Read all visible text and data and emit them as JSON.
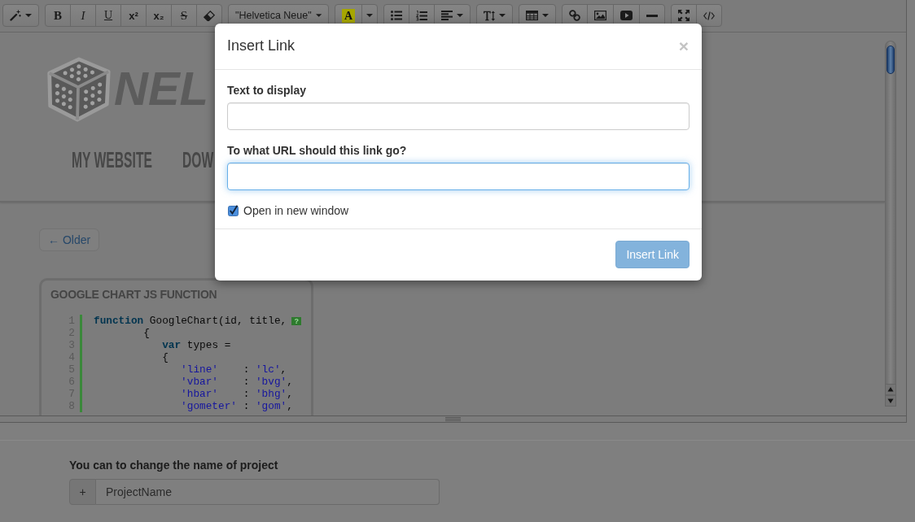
{
  "toolbar": {
    "groups": [
      {
        "buttons": [
          {
            "kind": "magic",
            "caret": true
          }
        ]
      },
      {
        "buttons": [
          {
            "kind": "bold",
            "label": "B",
            "caret": false
          },
          {
            "kind": "italic",
            "label": "I",
            "caret": false
          },
          {
            "kind": "underline",
            "label": "U",
            "caret": false
          },
          {
            "kind": "superscript",
            "label": "x²",
            "caret": false
          },
          {
            "kind": "subscript",
            "label": "x₂",
            "caret": false
          },
          {
            "kind": "strikethrough",
            "label": "S",
            "caret": false
          },
          {
            "kind": "eraser",
            "caret": false
          }
        ]
      },
      {
        "buttons": [
          {
            "kind": "font",
            "label": "\"Helvetica Neue\"",
            "caret": true
          }
        ]
      },
      {
        "buttons": [
          {
            "kind": "color",
            "label": "A",
            "caret": false
          },
          {
            "kind": "dropdown",
            "caret": true
          }
        ]
      },
      {
        "buttons": [
          {
            "kind": "unordered-list",
            "caret": false
          },
          {
            "kind": "ordered-list",
            "caret": false
          },
          {
            "kind": "align",
            "caret": true
          }
        ]
      },
      {
        "buttons": [
          {
            "kind": "text-height",
            "caret": true
          }
        ]
      },
      {
        "buttons": [
          {
            "kind": "table",
            "caret": true
          }
        ]
      },
      {
        "buttons": [
          {
            "kind": "link",
            "caret": false
          },
          {
            "kind": "picture",
            "caret": false
          },
          {
            "kind": "video",
            "caret": false
          },
          {
            "kind": "rule",
            "caret": false
          }
        ]
      },
      {
        "buttons": [
          {
            "kind": "fullscreen",
            "caret": false
          },
          {
            "kind": "code",
            "caret": false
          }
        ]
      }
    ]
  },
  "editor": {
    "logo": {
      "text": "NEL"
    },
    "nav": [
      {
        "label": "MY WEBSITE"
      },
      {
        "label": "DOW"
      }
    ],
    "older_button": {
      "label": "← Older"
    },
    "code_card": {
      "title": "GOOGLE CHART JS FUNCTION",
      "lines": [
        {
          "number": "1",
          "tokens": [
            {
              "kind": "keyword",
              "text": "function"
            },
            {
              "kind": "plain",
              "text": " GoogleChart(id, title,"
            }
          ],
          "marker": "?"
        },
        {
          "number": "2",
          "tokens": [
            {
              "kind": "plain",
              "text": "        {"
            }
          ]
        },
        {
          "number": "3",
          "tokens": [
            {
              "kind": "keyword",
              "text": "           var"
            },
            {
              "kind": "plain",
              "text": " types ="
            }
          ]
        },
        {
          "number": "4",
          "tokens": [
            {
              "kind": "plain",
              "text": "           {"
            }
          ]
        },
        {
          "number": "5",
          "tokens": [
            {
              "kind": "string",
              "text": "              'line'"
            },
            {
              "kind": "plain",
              "text": "    : "
            },
            {
              "kind": "string",
              "text": "'lc'"
            },
            {
              "kind": "plain",
              "text": ","
            }
          ]
        },
        {
          "number": "6",
          "tokens": [
            {
              "kind": "string",
              "text": "              'vbar'"
            },
            {
              "kind": "plain",
              "text": "    : "
            },
            {
              "kind": "string",
              "text": "'bvg'"
            },
            {
              "kind": "plain",
              "text": ","
            }
          ]
        },
        {
          "number": "7",
          "tokens": [
            {
              "kind": "string",
              "text": "              'hbar'"
            },
            {
              "kind": "plain",
              "text": "    : "
            },
            {
              "kind": "string",
              "text": "'bhg'"
            },
            {
              "kind": "plain",
              "text": ","
            }
          ]
        },
        {
          "number": "8",
          "tokens": [
            {
              "kind": "string",
              "text": "              'gometer'"
            },
            {
              "kind": "plain",
              "text": " : "
            },
            {
              "kind": "string",
              "text": "'gom'"
            },
            {
              "kind": "plain",
              "text": ","
            }
          ]
        }
      ]
    }
  },
  "project": {
    "label": "You can to change the name of project",
    "addon": "+",
    "value": "ProjectName"
  },
  "modal": {
    "title": "Insert Link",
    "close": "×",
    "fields": [
      {
        "label": "Text to display",
        "focused": false
      },
      {
        "label": "To what URL should this link go?",
        "focused": true
      }
    ],
    "checkbox": {
      "label": "Open in new window",
      "checked": true
    },
    "submit": {
      "label": "Insert Link",
      "disabled": true
    }
  }
}
